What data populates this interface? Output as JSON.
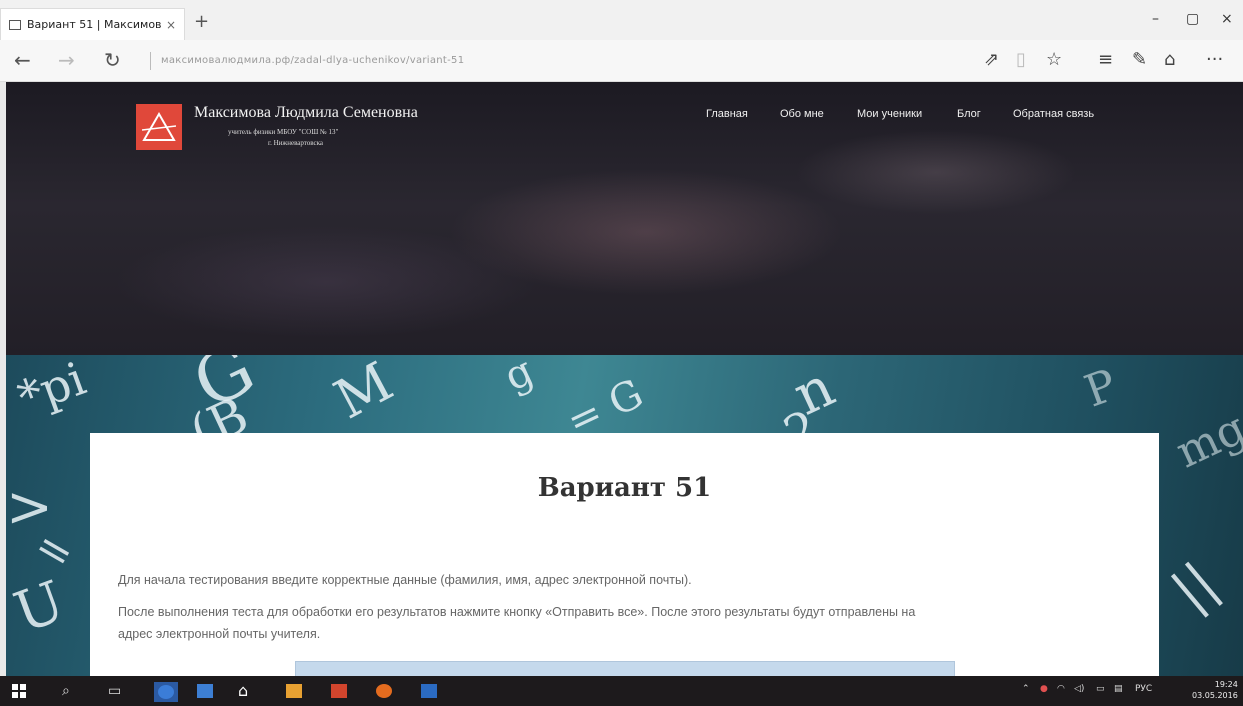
{
  "browser": {
    "tab_title": "Вариант 51 | Максимов",
    "tab_close": "×",
    "new_tab": "+",
    "address": "максимовалюдмила.рф/zadal-dlya-uchenikov/variant-51",
    "nav": {
      "back": "←",
      "forward": "→",
      "refresh": "↻"
    },
    "tools": {
      "reading": "⇗",
      "book": "▯",
      "favorite": "☆",
      "hub": "≡",
      "note": "✎",
      "share": "⌂",
      "more": "···"
    },
    "window": {
      "minimize": "–",
      "restore": "▢",
      "close": "×"
    }
  },
  "site": {
    "title": "Максимова Людмила Семеновна",
    "subtitle": "учитель физики МБОУ \"СОШ № 13\"",
    "subtitle2": "г. Нижневартовска",
    "menu": [
      "Главная",
      "Обо мне",
      "Мои ученики",
      "Блог",
      "Обратная связь"
    ]
  },
  "formula_glyphs": [
    "*pi",
    "G",
    "M",
    "(B",
    "g",
    "= G",
    "n",
    "2",
    "P",
    "mg",
    "U",
    "> ",
    "||",
    "="
  ],
  "content": {
    "title": "Вариант 51",
    "paragraph1": "Для начала тестирования введите корректные данные (фамилия, имя, адрес электронной почты).",
    "paragraph2_line1": "После выполнения теста для обработки его результатов нажмите кнопку «Отправить все». После этого результаты будут отправлены на",
    "paragraph2_line2": "адрес электронной почты учителя."
  },
  "taskbar": {
    "tray_lang": "РУС",
    "time": "19:24",
    "date": "03.05.2016"
  },
  "colors": {
    "accent_logo": "#e0483a",
    "formula_band": "#2c6c7e",
    "taskbar": "#1d1a1c"
  }
}
